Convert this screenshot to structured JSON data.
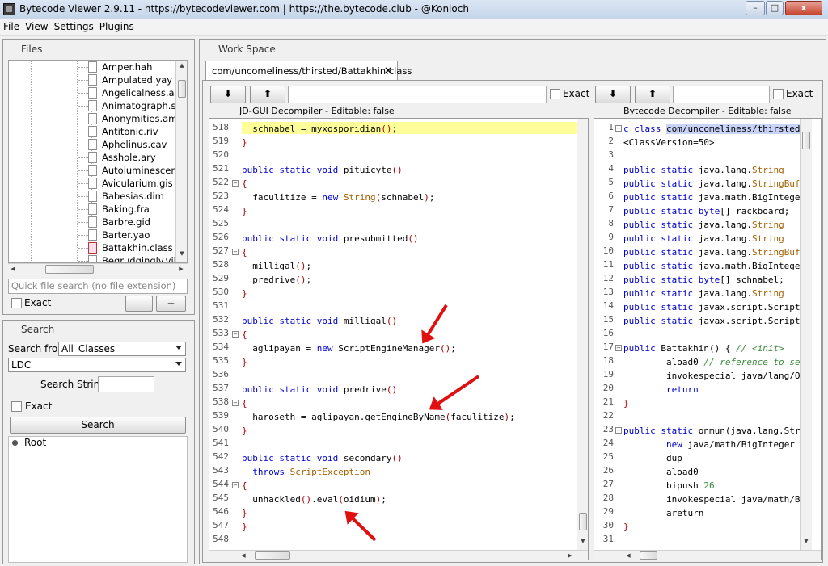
{
  "window": {
    "title": "Bytecode Viewer 2.9.11 - https://bytecodeviewer.com | https://the.bytecode.club - @Konloch",
    "minimize": "–",
    "maximize": "□",
    "close": "x"
  },
  "menu": [
    "File",
    "View",
    "Settings",
    "Plugins"
  ],
  "files": {
    "title": "Files",
    "items": [
      "Amper.hah",
      "Ampulated.yay",
      "Angelicalness.ala",
      "Animatograph.sem",
      "Anonymities.ami",
      "Antitonic.riv",
      "Aphelinus.cav",
      "Asshole.ary",
      "Autoluminescent.fl",
      "Avicularium.gis",
      "Babesias.dim",
      "Baking.fra",
      "Barbre.gid",
      "Barter.yao",
      "Battakhin.class",
      "Begrudgingly.vil"
    ],
    "quick_search_placeholder": "Quick file search (no file extension)",
    "exact_label": "Exact",
    "minus_label": "-",
    "plus_label": "+"
  },
  "search": {
    "title": "Search",
    "search_from_label": "Search from",
    "search_from_value": "All_Classes",
    "type_value": "LDC",
    "search_string_label": "Search String:",
    "exact_label": "Exact",
    "button_label": "Search",
    "root_label": "Root"
  },
  "workspace": {
    "title": "Work Space",
    "tab_label": "com/uncomeliness/thirsted/Battakhin.class",
    "tab_close": "×",
    "left": {
      "exact_label": "Exact",
      "decompiler_label": "JD-GUI Decompiler - Editable: false"
    },
    "right": {
      "exact_label": "Exact",
      "decompiler_label": "Bytecode Decompiler - Editable: false"
    }
  },
  "left_code": {
    "line_numbers": [
      "518",
      "519",
      "520",
      "521",
      "522",
      "523",
      "524",
      "525",
      "526",
      "527",
      "528",
      "529",
      "530",
      "531",
      "532",
      "533",
      "534",
      "535",
      "536",
      "537",
      "538",
      "539",
      "540",
      "541",
      "542",
      "543",
      "544",
      "545",
      "546",
      "547",
      "548"
    ]
  },
  "right_code": {
    "line_numbers": [
      "1",
      "2",
      "3",
      "4",
      "5",
      "6",
      "7",
      "8",
      "9",
      "10",
      "11",
      "12",
      "13",
      "14",
      "15",
      "16",
      "17",
      "18",
      "19",
      "20",
      "21",
      "22",
      "23",
      "24",
      "25",
      "26",
      "27",
      "28",
      "29",
      "30",
      "31"
    ]
  },
  "colors": {
    "highlight": "#ffff99",
    "arrow": "#e01010",
    "keyword": "#0000cc"
  }
}
